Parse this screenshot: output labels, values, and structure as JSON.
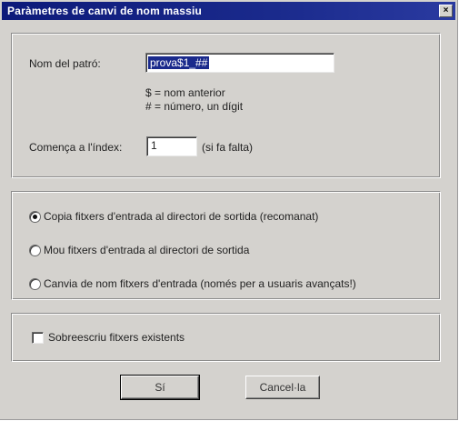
{
  "window": {
    "title": "Paràmetres de canvi de nom massiu",
    "close_glyph": "×"
  },
  "pattern": {
    "label": "Nom del patró:",
    "value": "prova$1_##",
    "hint_line1": "$ = nom anterior",
    "hint_line2": "# = número, un dígit"
  },
  "index": {
    "label": "Comença a l'índex:",
    "value": "1",
    "suffix": "(si fa falta)"
  },
  "options": [
    {
      "label": "Copia fitxers d'entrada al directori de sortida (recomanat)",
      "selected": true
    },
    {
      "label": "Mou fitxers d'entrada al directori de sortida",
      "selected": false
    },
    {
      "label": "Canvia de nom fitxers d'entrada (només per a usuaris avançats!)",
      "selected": false
    }
  ],
  "overwrite": {
    "label": "Sobreescriu fitxers existents",
    "checked": false
  },
  "buttons": {
    "ok_label": "Sí",
    "cancel_label": "Cancel·la"
  }
}
